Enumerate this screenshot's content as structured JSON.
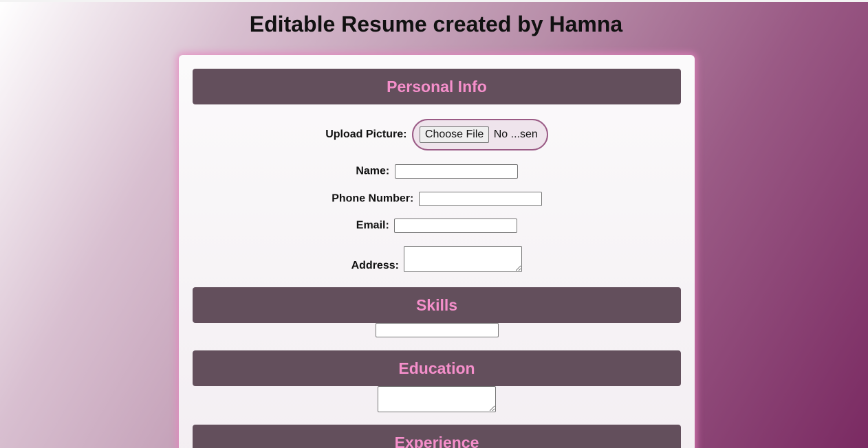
{
  "page": {
    "title": "Editable Resume created by Hamna"
  },
  "sections": {
    "personal_info": "Personal Info",
    "skills": "Skills",
    "education": "Education",
    "experience": "Experience"
  },
  "form": {
    "upload_label": "Upload Picture:",
    "file_button": "Choose File",
    "file_status": "No ...sen",
    "name_label": "Name:",
    "name_value": "",
    "phone_label": "Phone Number:",
    "phone_value": "",
    "email_label": "Email:",
    "email_value": "",
    "address_label": "Address:",
    "address_value": "",
    "skills_value": "",
    "education_value": ""
  },
  "colors": {
    "header_bg": "#634f5c",
    "header_text": "#f58fcb",
    "card_glow": "#e682be",
    "gradient_end": "#7a2a62"
  }
}
